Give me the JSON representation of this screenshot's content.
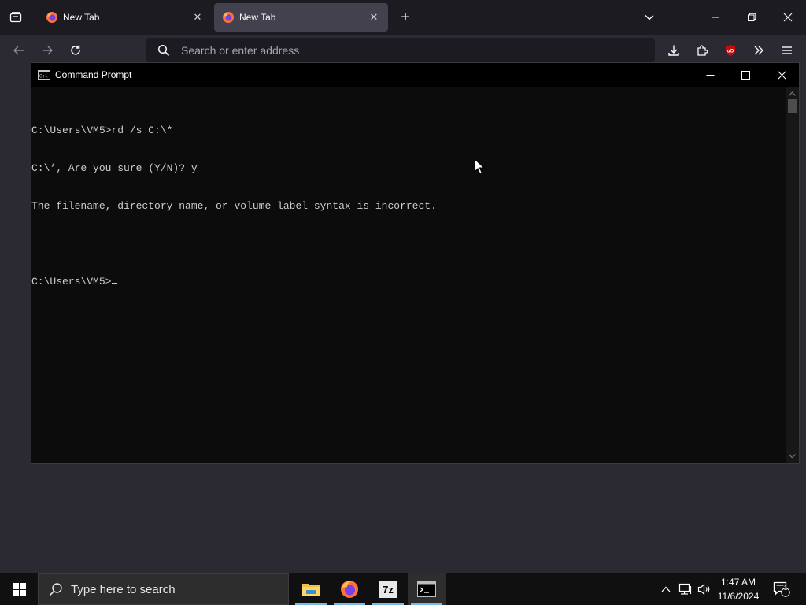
{
  "browser": {
    "tabs": [
      {
        "label": "New Tab",
        "active": false
      },
      {
        "label": "New Tab",
        "active": true
      }
    ],
    "urlbar_placeholder": "Search or enter address"
  },
  "cmd": {
    "title": "Command Prompt",
    "lines": [
      "C:\\Users\\VM5>rd /s C:\\*",
      "C:\\*, Are you sure (Y/N)? y",
      "The filename, directory name, or volume label syntax is incorrect.",
      "",
      "C:\\Users\\VM5>"
    ]
  },
  "taskbar": {
    "search_text": "Type here to search",
    "apps": [
      "file-explorer",
      "firefox",
      "7zip",
      "command-prompt"
    ],
    "sevenzip_label": "7z",
    "time": "1:47 AM",
    "date": "11/6/2024",
    "notification_count": "1"
  },
  "colors": {
    "browser_bg": "#2b2a33",
    "tabbar_bg": "#1c1b22",
    "active_tab": "#42414d",
    "cmd_bg": "#0c0c0c",
    "cmd_text": "#cccccc",
    "taskbar_bg": "#101010",
    "taskbar_accent": "#76b9ed"
  }
}
